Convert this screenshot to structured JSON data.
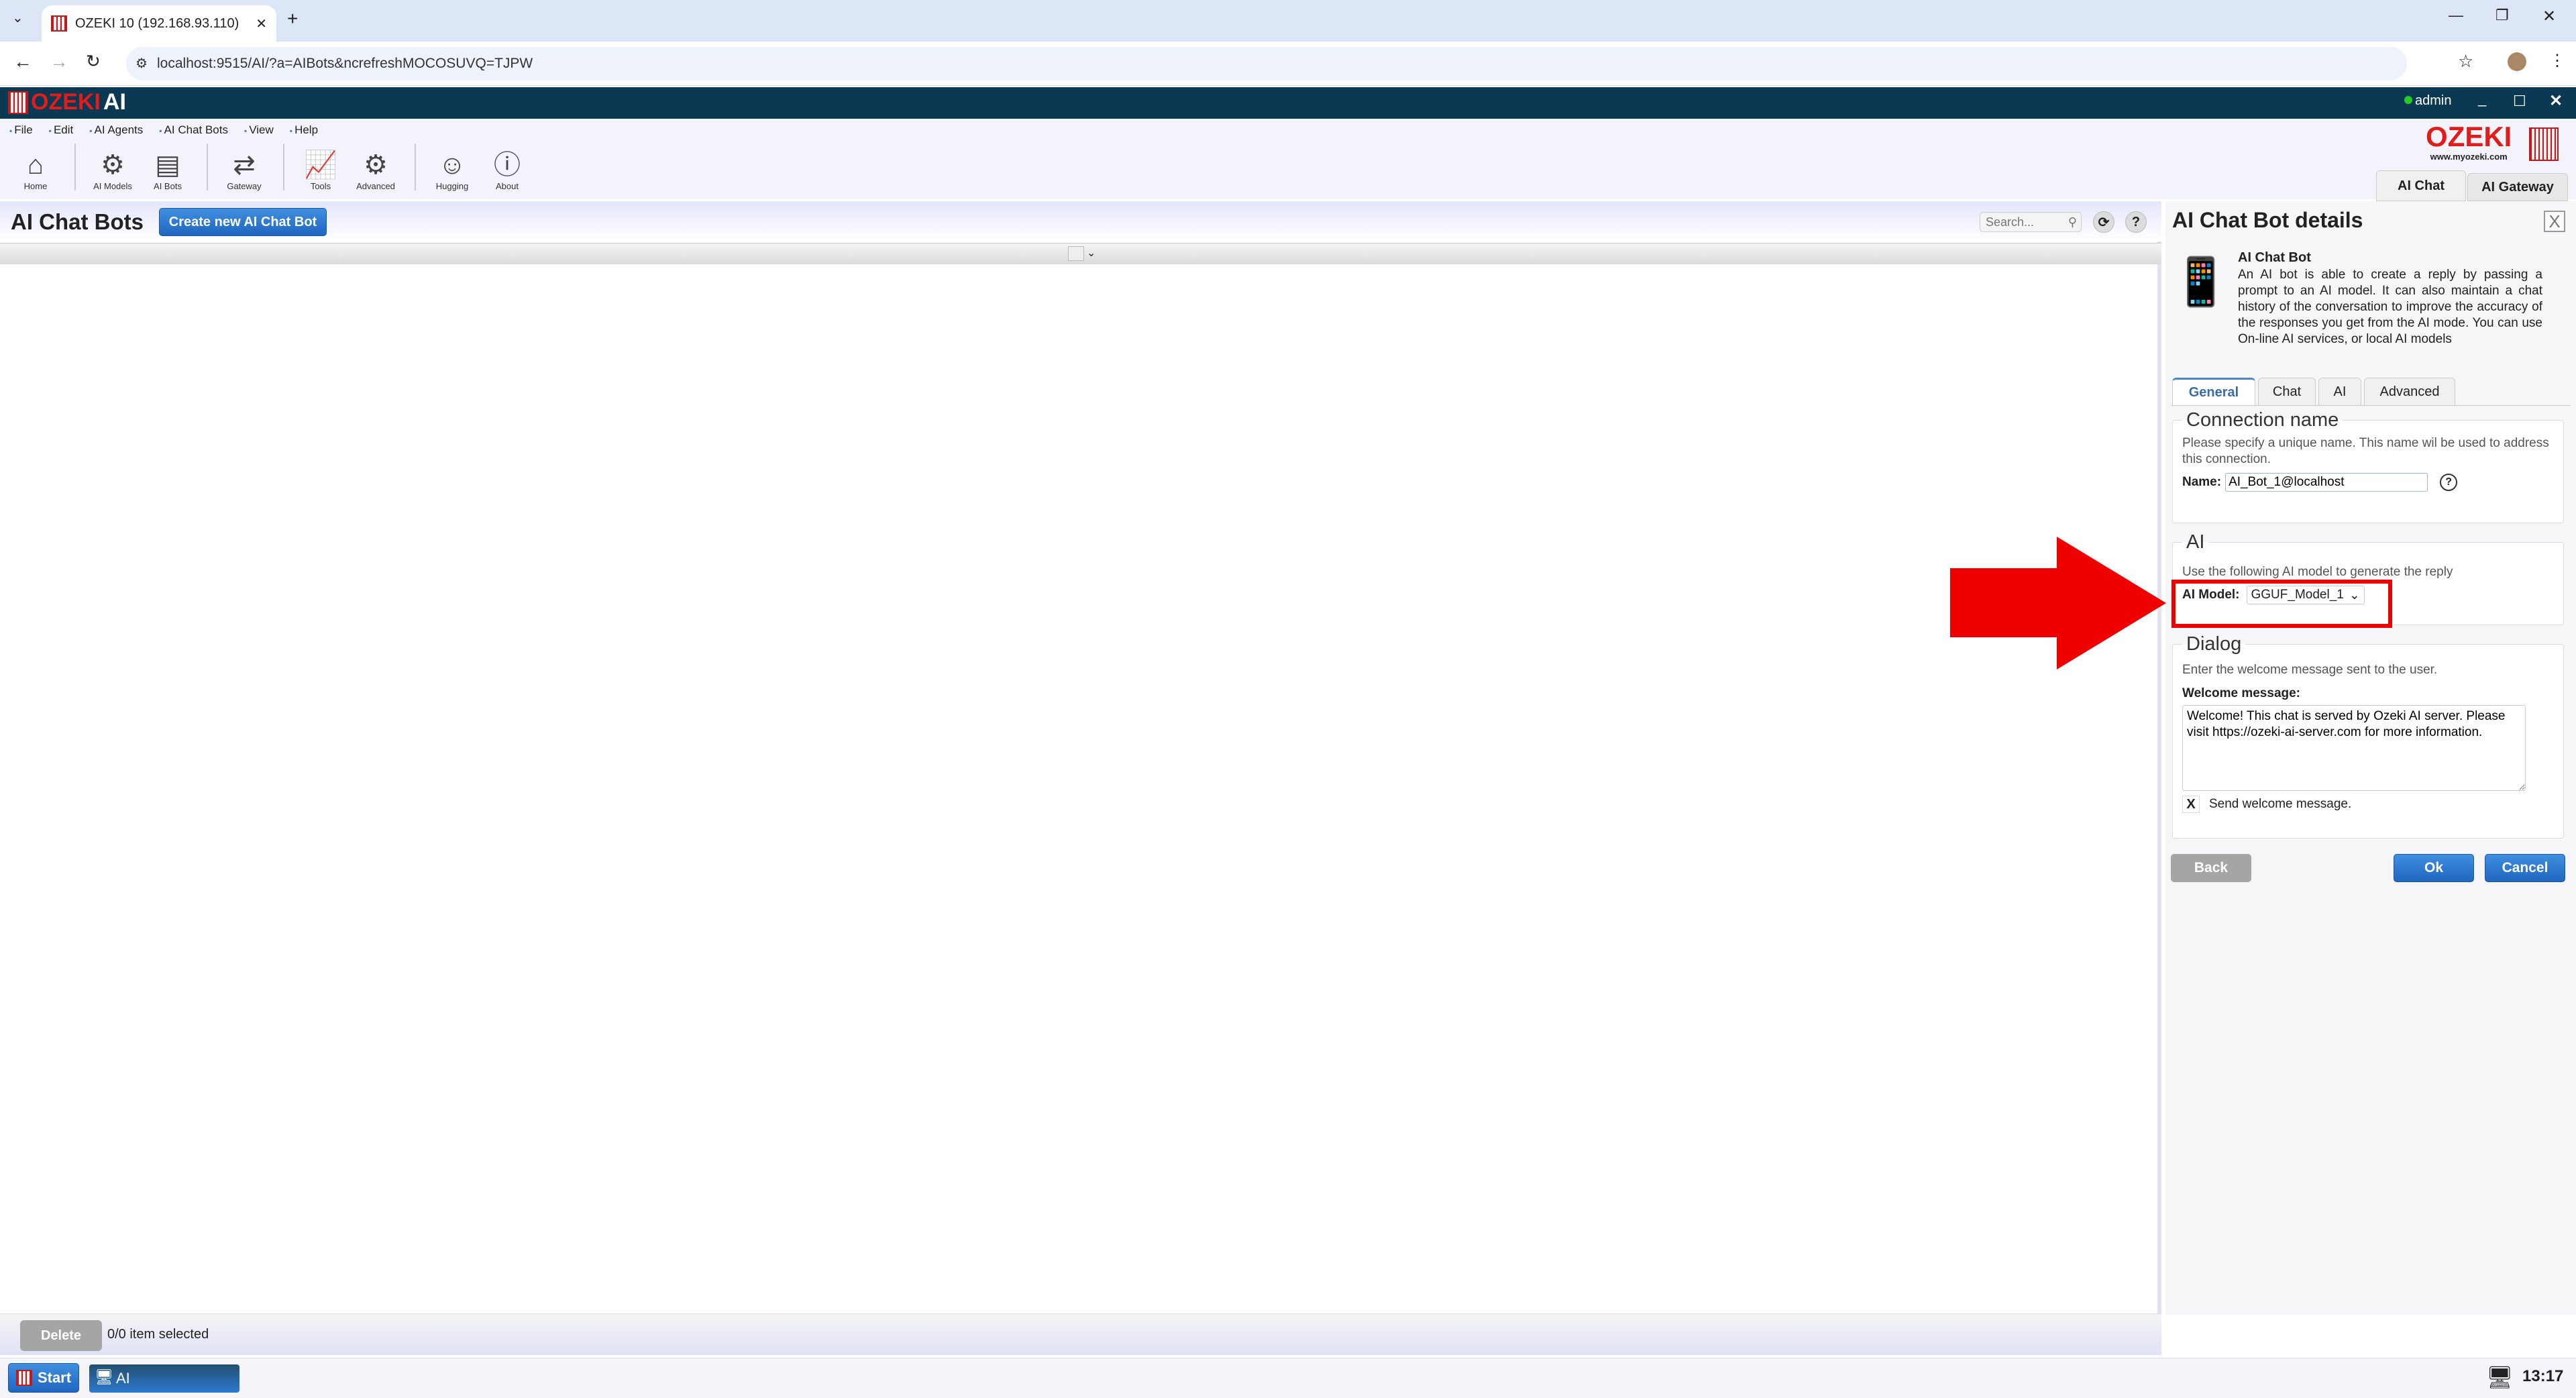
{
  "browser": {
    "tab_title": "OZEKI 10 (192.168.93.110)",
    "url": "localhost:9515/AI/?a=AIBots&ncrefreshMOCOSUVQ=TJPW"
  },
  "app": {
    "logo_brand": "OZEKI",
    "logo_product": "AI",
    "user": "admin",
    "brand_logo": "OZEKI",
    "brand_url": "www.myozeki.com"
  },
  "menu": [
    "File",
    "Edit",
    "AI Agents",
    "AI Chat Bots",
    "View",
    "Help"
  ],
  "toolbar": [
    {
      "label": "Home",
      "icon": "home-icon"
    },
    {
      "label": "AI Models",
      "icon": "ai-models-icon"
    },
    {
      "label": "AI Bots",
      "icon": "ai-bots-icon"
    },
    {
      "label": "Gateway",
      "icon": "gateway-icon"
    },
    {
      "label": "Tools",
      "icon": "tools-icon"
    },
    {
      "label": "Advanced",
      "icon": "gear-icon"
    },
    {
      "label": "Hugging",
      "icon": "hugging-face-icon"
    },
    {
      "label": "About",
      "icon": "info-icon"
    }
  ],
  "app_tabs": [
    "AI Chat",
    "AI Gateway"
  ],
  "main": {
    "title": "AI Chat Bots",
    "create_label": "Create new AI Chat Bot",
    "search_placeholder": "Search...",
    "delete_label": "Delete",
    "selection_status": "0/0 item selected"
  },
  "details": {
    "title": "AI Chat Bot details",
    "close": "X",
    "heading": "AI Chat Bot",
    "description": "An AI bot is able to create a reply by passing a prompt to an AI model. It can also maintain a chat history of the conversation to improve the accuracy of the responses you get from the AI mode. You can use On-line AI services, or local AI models",
    "tabs": [
      "General",
      "Chat",
      "AI",
      "Advanced"
    ],
    "connection": {
      "legend": "Connection name",
      "help": "Please specify a unique name. This name wil be used to address this connection.",
      "name_label": "Name:",
      "name_value": "AI_Bot_1@localhost"
    },
    "ai": {
      "legend": "AI",
      "help": "Use the following AI model to generate the reply",
      "model_label": "AI Model:",
      "model_value": "GGUF_Model_1"
    },
    "dialog": {
      "legend": "Dialog",
      "help": "Enter the welcome message sent to the user.",
      "welcome_label": "Welcome message:",
      "welcome_value": "Welcome! This chat is served by Ozeki AI server. Please visit https://ozeki-ai-server.com for more information.",
      "send_checkbox": "X",
      "send_label": "Send welcome message."
    },
    "buttons": {
      "back": "Back",
      "ok": "Ok",
      "cancel": "Cancel"
    }
  },
  "taskbar": {
    "start": "Start",
    "app": "AI",
    "clock": "13:17"
  },
  "colors": {
    "header": "#0b3954",
    "accent": "#1f66c0",
    "annotation": "#ee0000"
  }
}
